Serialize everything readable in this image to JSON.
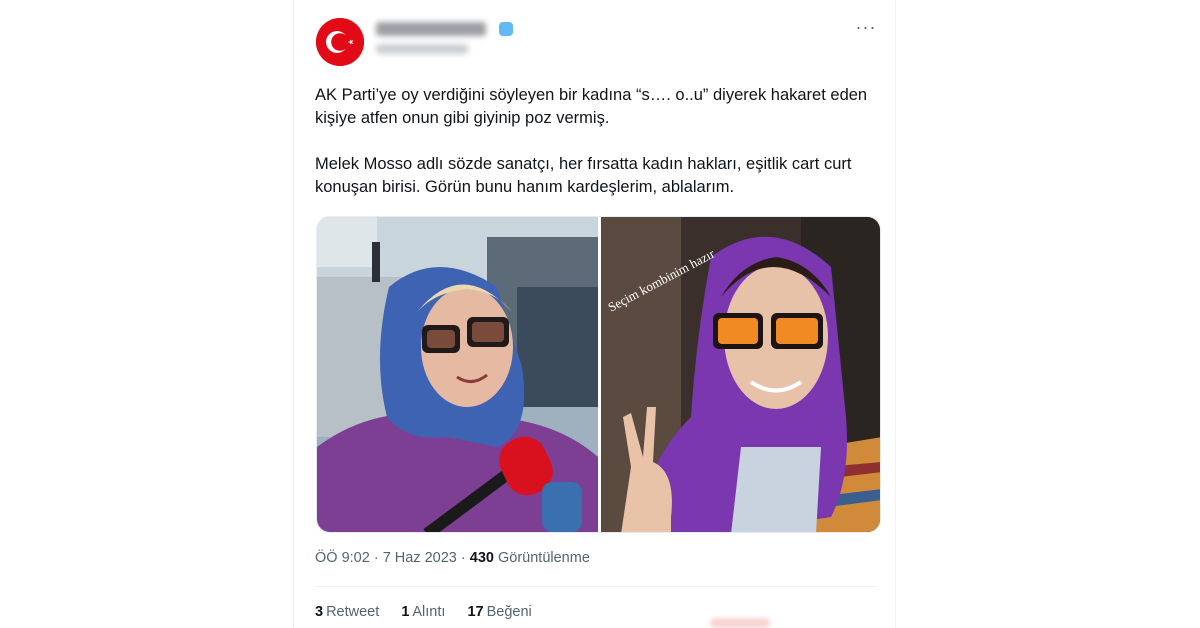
{
  "tweet": {
    "paragraph1": "AK Parti’ye oy verdiğini söyleyen bir kadına “s…. o..u” diyerek hakaret eden kişiye atfen onun gibi giyinip poz vermiş.",
    "paragraph2": "Melek Mosso adlı sözde sanatçı, her fırsatta kadın hakları, eşitlik cart curt konuşan birisi. Görün bunu hanım kardeşlerim, ablalarım.",
    "more_icon": "more-dots-icon",
    "verified_icon": "verified-badge-icon",
    "verified_color": "#1d9bf0",
    "avatar_flag_color": "#e30a17"
  },
  "media": {
    "right_photo_caption": "Seçim kombinim hazır"
  },
  "meta": {
    "time": "ÖÖ 9:02",
    "separator1": " · ",
    "date": "7 Haz 2023",
    "separator2": " · ",
    "views_count": "430",
    "views_label": "Görüntülenme"
  },
  "stats": {
    "retweets_count": "3",
    "retweets_label": "Retweet",
    "quotes_count": "1",
    "quotes_label": "Alıntı",
    "likes_count": "17",
    "likes_label": "Beğeni"
  }
}
